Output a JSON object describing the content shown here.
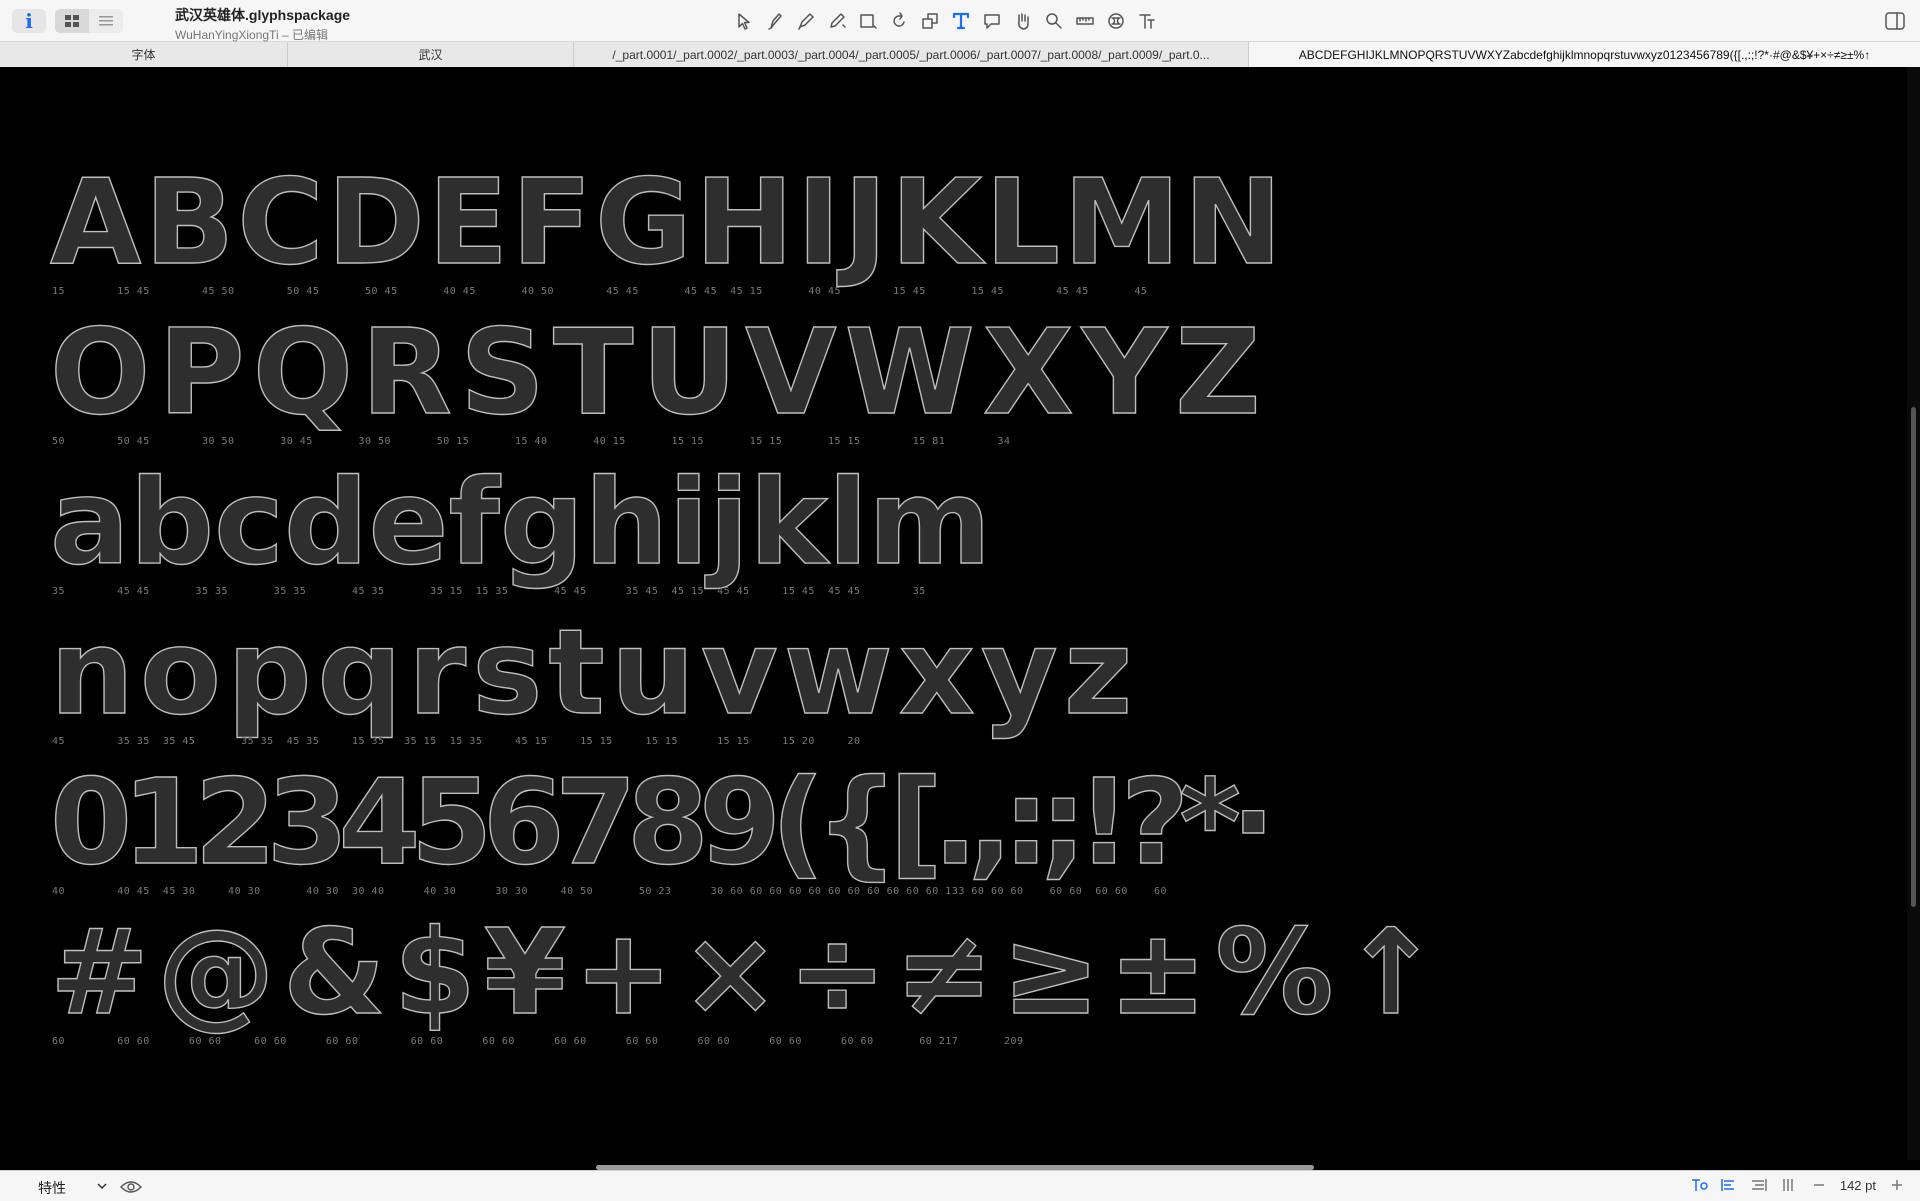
{
  "window": {
    "title": "武汉英雄体.glyphspackage",
    "subtitle": "WuHanYingXiongTi – 已编辑"
  },
  "toolbar": {
    "info_label": "i",
    "view_modes": [
      "grid-view-icon",
      "list-view-icon"
    ],
    "tools": [
      "select-tool-icon",
      "draw-tool-icon",
      "pen-tool-icon",
      "pencil-tool-icon",
      "primitives-tool-icon",
      "rotate-tool-icon",
      "scale-tool-icon",
      "text-tool-icon",
      "annotation-tool-icon",
      "hand-tool-icon",
      "zoom-tool-icon",
      "measure-tool-icon",
      "components-tool-icon",
      "glyph-info-tool-icon"
    ],
    "active_tool": "text-tool-icon"
  },
  "tabs": [
    {
      "label": "字体",
      "active": false
    },
    {
      "label": "武汉",
      "active": false
    },
    {
      "label": "/_part.0001/_part.0002/_part.0003/_part.0004/_part.0005/_part.0006/_part.0007/_part.0008/_part.0009/_part.0...",
      "active": false
    },
    {
      "label": "ABCDEFGHIJKLMNOPQRSTUVWXYZabcdefghijklmnopqrstuvwxyz0123456789({[.,:;!?*·#@&$¥+×÷≠≥±%↑",
      "active": true
    }
  ],
  "canvas": {
    "rows": [
      {
        "glyphs": "ABCDEFGHIJKLMN",
        "metrics": "15        15 45        45 50        50 45       50 45       40 45       40 50        45 45       45 45  45 15       40 45        15 45       15 45        45 45       45"
      },
      {
        "glyphs": "OPQRSTUVWXYZ",
        "metrics": "50        50 45        30 50       30 45       30 50       50 15       15 40       40 15       15 15       15 15       15 15        15 81        34"
      },
      {
        "glyphs": "abcdefghijklm",
        "metrics": "35        45 45       35 35       35 35       45 35       35 15  15 35       45 45      35 45  45 15  45 45     15 45  45 45        35"
      },
      {
        "glyphs": "nopqrstuvwxyz",
        "metrics": "45        35 35  35 45       35 35  45 35     15 35   35 15  15 35     45 15     15 15     15 15      15 15     15 20     20"
      },
      {
        "glyphs": "0123456789({[.,:;!?*·",
        "metrics": "40        40 45  45 30     40 30       40 30  30 40      40 30      30 30     40 50       50 23      30 60 60 60 60 60 60 60 60 60 60 60 133 60 60 60    60 60  60 60    60"
      },
      {
        "glyphs": "#@&$¥+×÷≠≥±%↑",
        "metrics": "60        60 60      60 60     60 60      60 60        60 60      60 60      60 60      60 60      60 60      60 60      60 60       60 217       209"
      }
    ]
  },
  "statusbar": {
    "left_label": "特性",
    "zoom": "142 pt"
  }
}
